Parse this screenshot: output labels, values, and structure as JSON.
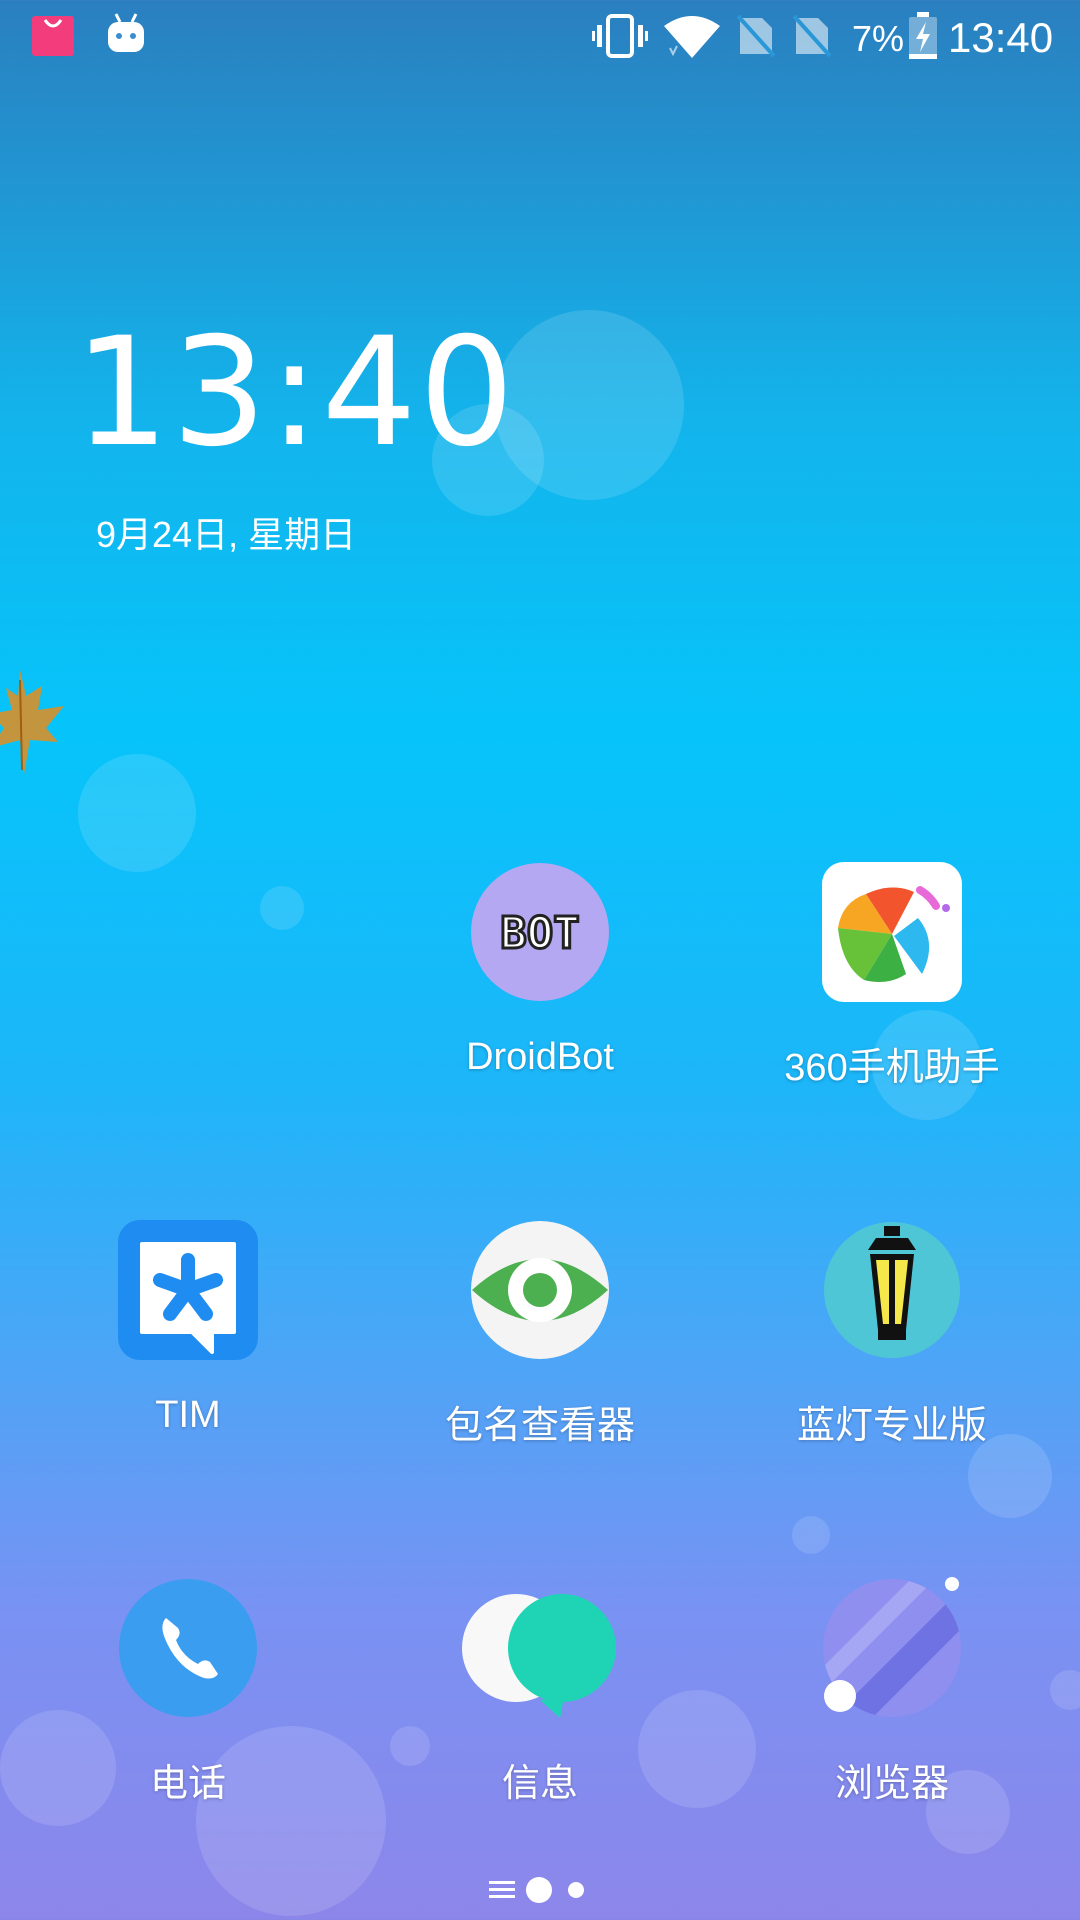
{
  "status_bar": {
    "battery_percent": "7%",
    "time": "13:40",
    "icons": [
      "shopping-bag-icon",
      "android-robot-icon",
      "vibrate-icon",
      "wifi-icon",
      "no-sim-icon",
      "no-sim-icon",
      "battery-charging-icon"
    ]
  },
  "clock_widget": {
    "time": "13:40",
    "date": "9月24日, 星期日"
  },
  "apps": {
    "droidbot": "DroidBot",
    "assistant360": "360手机助手",
    "tim": "TIM",
    "package_viewer": "包名查看器",
    "lantern": "蓝灯专业版"
  },
  "dock": {
    "phone": "电话",
    "messages": "信息",
    "browser": "浏览器"
  },
  "droidbot_icon_text": "BOT",
  "colors": {
    "shop_pink": "#f23c7c",
    "droidbot_purple": "#b5a8f2",
    "tim_blue": "#1e8cf0",
    "eye_green": "#4caf50",
    "messages_teal": "#1ed4b5"
  }
}
